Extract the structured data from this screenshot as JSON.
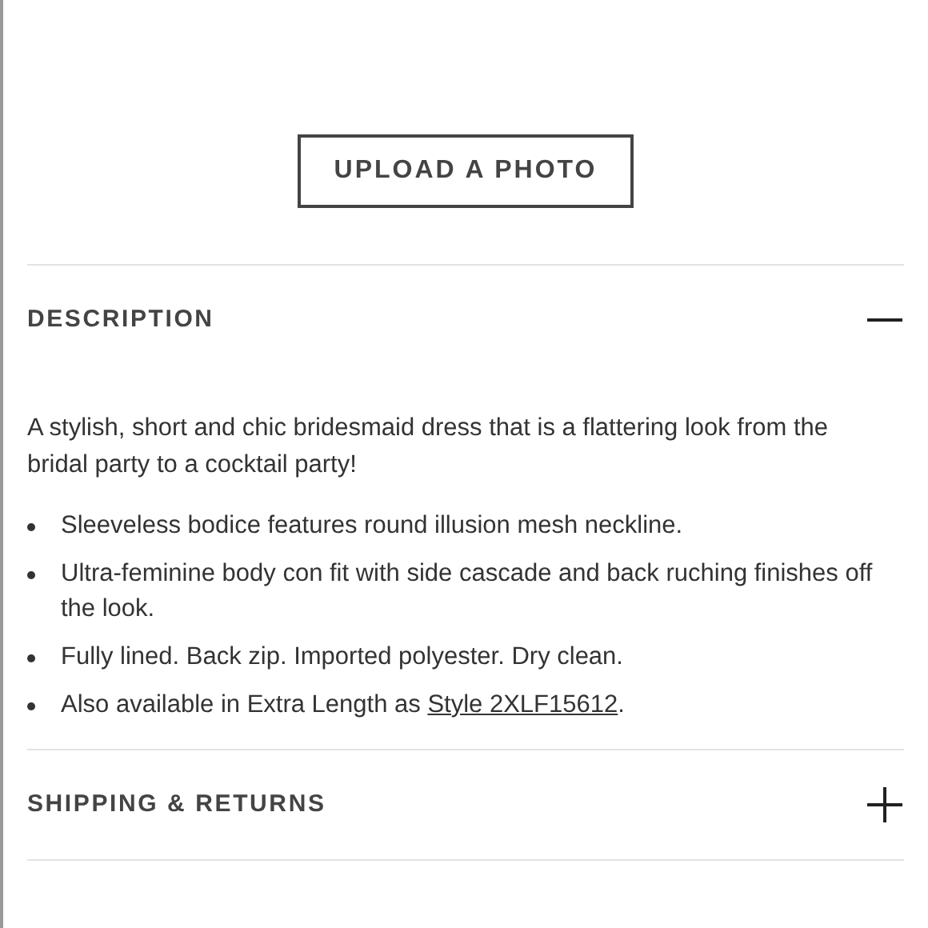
{
  "upload_button": "UPLOAD A PHOTO",
  "sections": [
    {
      "title": "DESCRIPTION",
      "expanded": true,
      "intro": "A stylish, short and chic bridesmaid dress that is a flattering look from the bridal party to a cocktail party!",
      "bullets": [
        {
          "text": "Sleeveless bodice features round illusion mesh neckline."
        },
        {
          "text": "Ultra-feminine body con fit with side cascade and back ruching finishes off the look."
        },
        {
          "text": "Fully lined. Back zip. Imported polyester. Dry clean."
        },
        {
          "text": "Also available in Extra Length as ",
          "link": "Style 2XLF15612",
          "after": "."
        }
      ]
    },
    {
      "title": "SHIPPING & RETURNS",
      "expanded": false
    }
  ]
}
